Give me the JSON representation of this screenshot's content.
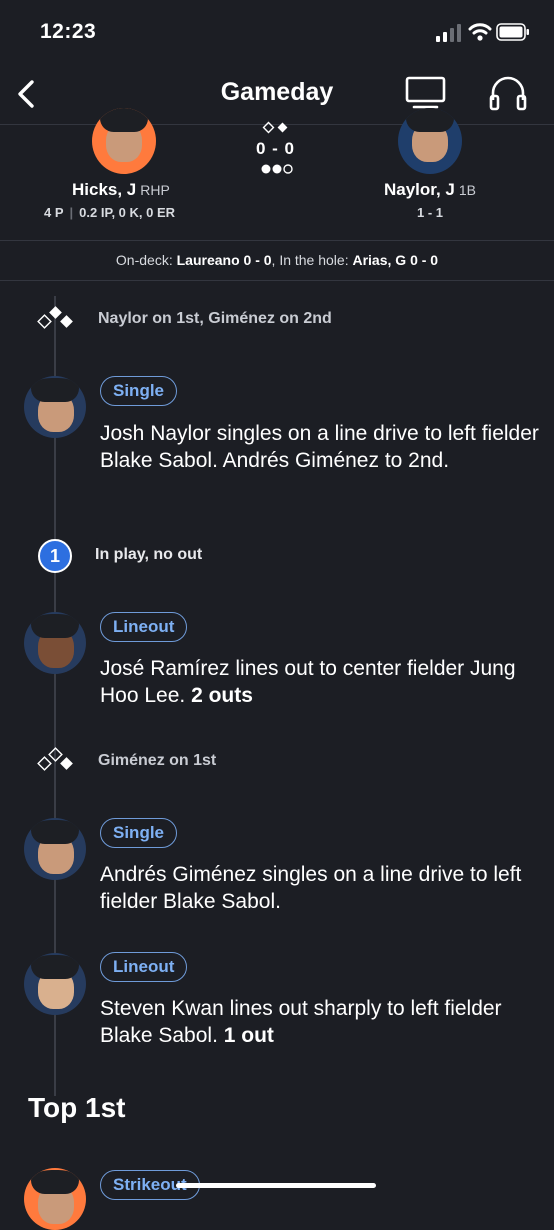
{
  "status_bar": {
    "time": "12:23"
  },
  "nav": {
    "title": "Gameday"
  },
  "matchup": {
    "pitcher": {
      "name": "Hicks, J",
      "pos": "RHP",
      "pitches": "4 P",
      "line": "0.2 IP, 0 K, 0 ER"
    },
    "batter": {
      "name": "Naylor, J",
      "pos": "1B",
      "line": "1 - 1"
    },
    "score": "0 - 0",
    "outs": 2
  },
  "ondeck": {
    "label1": "On-deck:",
    "value1": "Laureano 0 - 0",
    "label2": "In the hole:",
    "value2": "Arias, G 0 - 0"
  },
  "plays": [
    {
      "type": "bases",
      "text": "Naylor on 1st, Giménez on 2nd"
    },
    {
      "type": "play",
      "badge": "Single",
      "desc": "Josh Naylor singles on a line drive to left fielder Blake Sabol. Andrés Giménez to 2nd.",
      "outs": ""
    },
    {
      "type": "count",
      "number": "1",
      "text": "In play, no out"
    },
    {
      "type": "play",
      "badge": "Lineout",
      "desc": "José Ramírez lines out to center fielder Jung Hoo Lee.",
      "outs": "2 outs"
    },
    {
      "type": "bases",
      "text": "Giménez on 1st"
    },
    {
      "type": "play",
      "badge": "Single",
      "desc": "Andrés Giménez singles on a line drive to left fielder Blake Sabol.",
      "outs": ""
    },
    {
      "type": "play",
      "badge": "Lineout",
      "desc": "Steven Kwan lines out sharply to left fielder Blake Sabol.",
      "outs": "1 out"
    }
  ],
  "inning_header": "Top 1st",
  "next_play": {
    "badge": "Strikeout"
  },
  "colors": {
    "background": "#1c1e24",
    "accent": "#2d6fe0",
    "pill": "#7eb0f3"
  }
}
